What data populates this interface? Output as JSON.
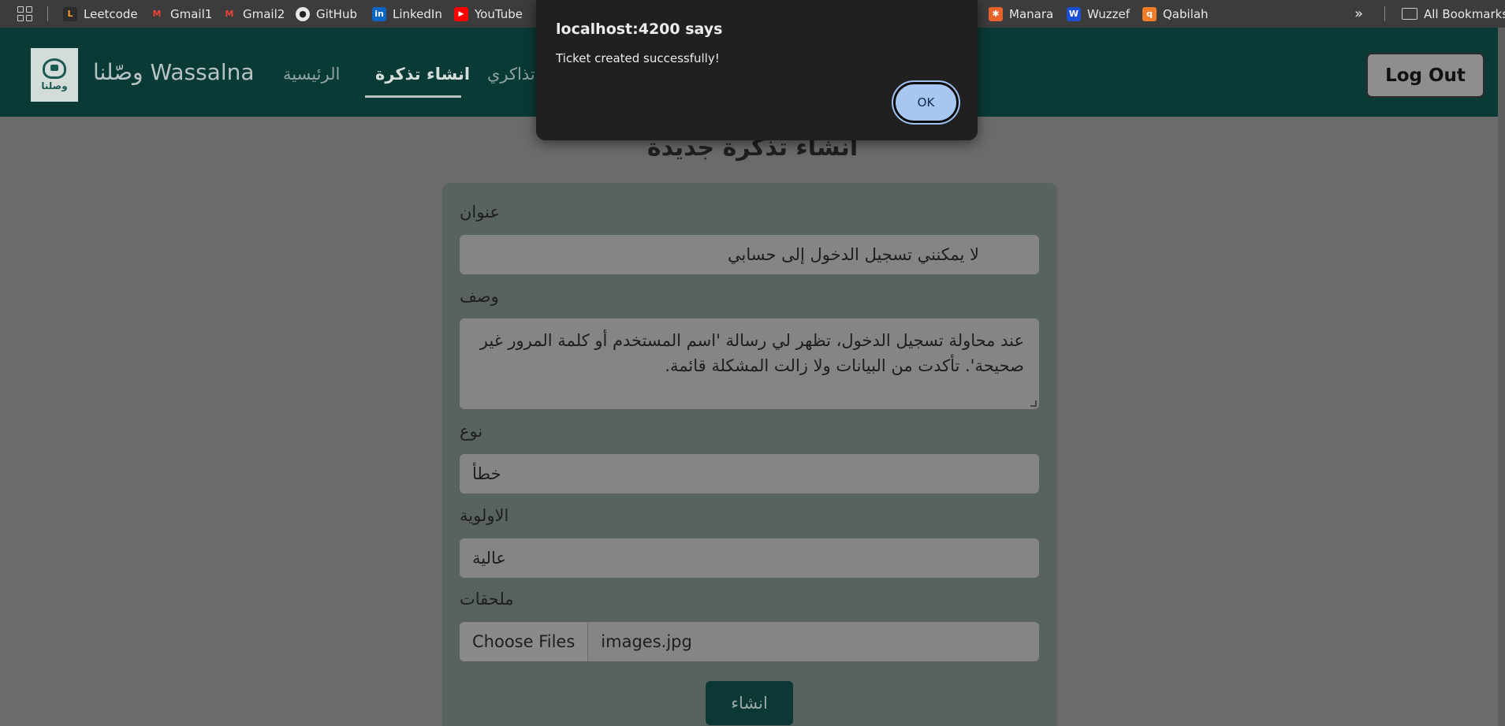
{
  "bookmarks": {
    "items": [
      {
        "label": "Leetcode",
        "icon": "leetcode-icon"
      },
      {
        "label": "Gmail1",
        "icon": "gmail-icon"
      },
      {
        "label": "Gmail2",
        "icon": "gmail-icon"
      },
      {
        "label": "GitHub",
        "icon": "github-icon"
      },
      {
        "label": "LinkedIn",
        "icon": "linkedin-icon"
      },
      {
        "label": "YouTube",
        "icon": "youtube-icon"
      },
      {
        "label": "Manara",
        "icon": "manara-icon"
      },
      {
        "label": "Wuzzef",
        "icon": "wuzzuf-icon"
      },
      {
        "label": "Qabilah",
        "icon": "qabilah-icon"
      }
    ],
    "more": "»",
    "all_bookmarks": "All Bookmarks"
  },
  "header": {
    "logo_text": "وصلنا",
    "brand": "وصّلنا Wassalna",
    "nav": [
      "الرئيسية",
      "انشاء تذكرة",
      "تذاكري"
    ],
    "logout": "Log Out"
  },
  "page": {
    "title": "انشاء تذكرة جديدة"
  },
  "form": {
    "title_label": "عنوان",
    "title_value": "لا يمكنني تسجيل الدخول إلى حسابي",
    "description_label": "وصف",
    "description_value": "عند محاولة تسجيل الدخول، تظهر لي رسالة 'اسم المستخدم أو كلمة المرور غير صحيحة'. تأكدت من البيانات ولا زالت المشكلة قائمة.",
    "type_label": "نوع",
    "type_value": "خطأ",
    "priority_label": "الاولوية",
    "priority_value": "عالية",
    "attachments_label": "ملحقات",
    "choose_files": "Choose Files",
    "file_name": "images.jpg",
    "submit": "انشاء"
  },
  "dialog": {
    "title": "localhost:4200 says",
    "message": "Ticket created successfully!",
    "ok": "OK"
  },
  "colors": {
    "header_bg": "#0a3a36",
    "page_overlay_bg": "#6b6b6b",
    "card_bg": "#58635f",
    "dialog_bg": "#202020",
    "ok_button": "#a7c7f2"
  }
}
